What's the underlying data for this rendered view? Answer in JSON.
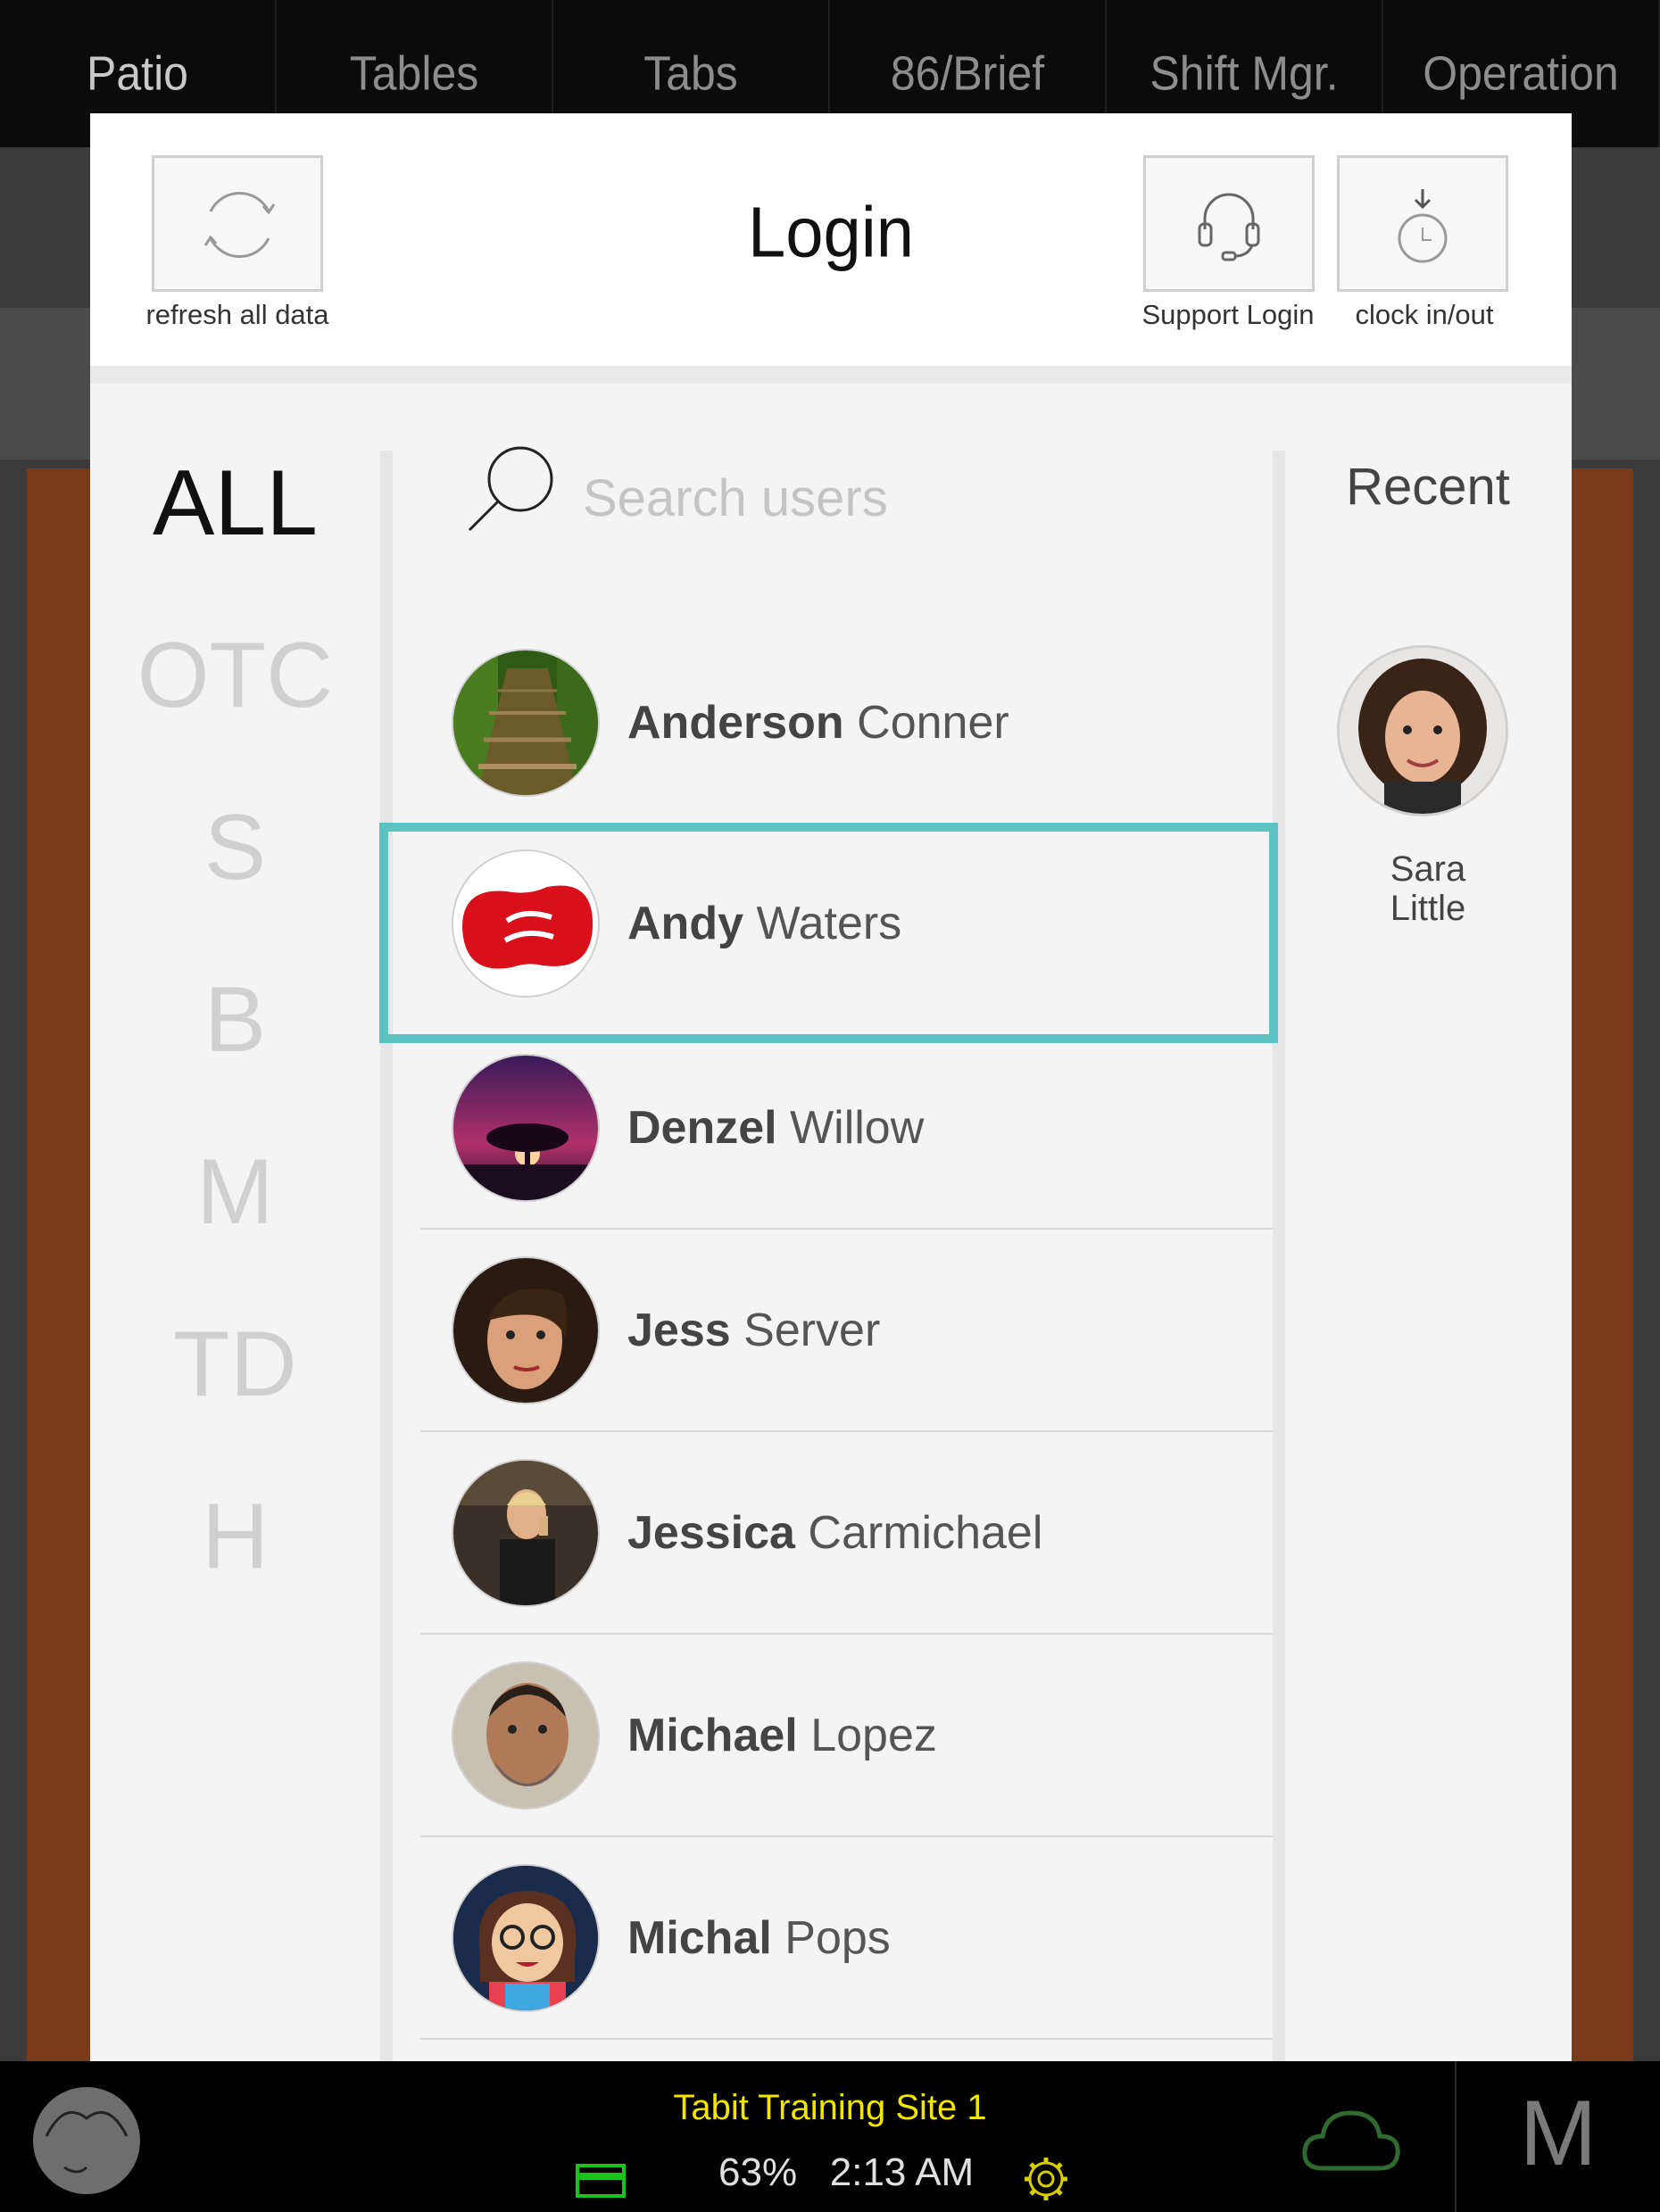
{
  "top_tabs": [
    "Patio",
    "Tables",
    "Tabs",
    "86/Brief",
    "Shift Mgr.",
    "Operation"
  ],
  "header": {
    "title": "Login",
    "refresh_label": "refresh all data",
    "support_label": "Support Login",
    "clock_label": "clock in/out"
  },
  "letter_filters": [
    "ALL",
    "OTC",
    "S",
    "B",
    "M",
    "TD",
    "H"
  ],
  "active_filter": "ALL",
  "search": {
    "placeholder": "Search users",
    "value": ""
  },
  "users": [
    {
      "first": "Anderson",
      "last": "Conner",
      "avatar": "forest-path-photo",
      "selected": false
    },
    {
      "first": "Andy",
      "last": "Waters",
      "avatar": "jelly-belly-bean-logo",
      "selected": true
    },
    {
      "first": "Denzel",
      "last": "Willow",
      "avatar": "sunset-tree-photo",
      "selected": false
    },
    {
      "first": "Jess",
      "last": "Server",
      "avatar": "woman-portrait-photo",
      "selected": false
    },
    {
      "first": "Jessica",
      "last": "Carmichael",
      "avatar": "woman-drinking-photo",
      "selected": false
    },
    {
      "first": "Michael",
      "last": "Lopez",
      "avatar": "man-portrait-photo",
      "selected": false
    },
    {
      "first": "Michal",
      "last": "Pops",
      "avatar": "cartoon-girl-avatar",
      "selected": false
    }
  ],
  "recent": {
    "title": "Recent",
    "users": [
      {
        "first": "Sara",
        "last": "Little",
        "avatar": "curly-hair-woman-photo"
      }
    ]
  },
  "footer": {
    "site_name": "Tabit Training Site 1",
    "battery": "63%",
    "time": "2:13 AM",
    "user_initial": "M"
  },
  "colors": {
    "selection_border": "#5dc2c2",
    "site_name": "#f2e600",
    "cloud_icon": "#2f6b2f",
    "card_icon": "#19c319",
    "settings_icon": "#d8cd00"
  }
}
